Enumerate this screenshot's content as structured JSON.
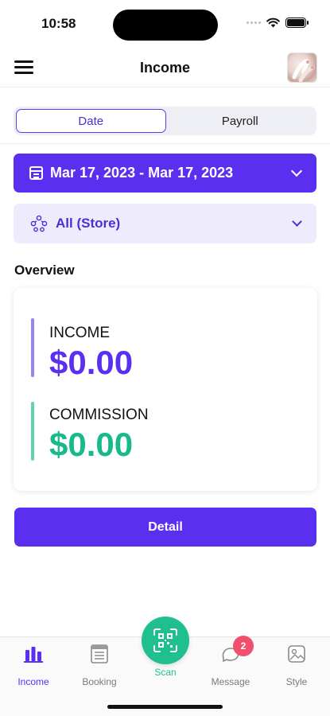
{
  "status_bar": {
    "time": "10:58"
  },
  "header": {
    "title": "Income"
  },
  "segments": [
    {
      "label": "Date",
      "active": true
    },
    {
      "label": "Payroll",
      "active": false
    }
  ],
  "date_range": {
    "label": "Mar 17, 2023 - Mar 17, 2023"
  },
  "store_filter": {
    "label": "All (Store)"
  },
  "overview": {
    "heading": "Overview",
    "income": {
      "label": "INCOME",
      "value": "$0.00"
    },
    "commission": {
      "label": "COMMISSION",
      "value": "$0.00"
    }
  },
  "detail_button": {
    "label": "Detail"
  },
  "tabbar": {
    "income": "Income",
    "booking": "Booking",
    "scan": "Scan",
    "message": "Message",
    "message_badge": "2",
    "style": "Style"
  },
  "colors": {
    "primary": "#5b2ff0",
    "commission": "#18b98a",
    "scan": "#1fbf8f",
    "badge": "#f0506e"
  },
  "icons": [
    "menu-icon",
    "calendar-icon",
    "store-group-icon",
    "chevron-down-icon",
    "bar-chart-icon",
    "booking-icon",
    "qr-scan-icon",
    "message-icon",
    "style-icon"
  ]
}
